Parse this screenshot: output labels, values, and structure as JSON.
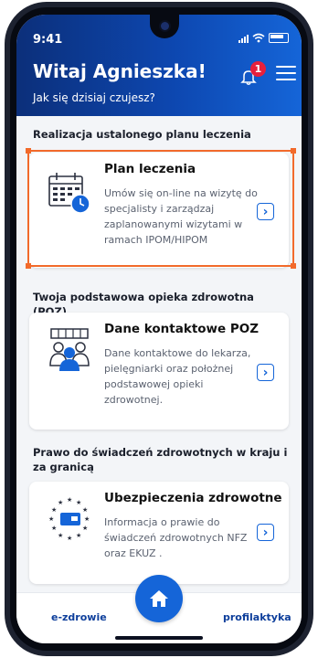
{
  "status": {
    "time": "9:41"
  },
  "header": {
    "greeting": "Witaj Agnieszka!",
    "subtitle": "Jak się dzisiaj czujesz?",
    "notification_count": "1"
  },
  "sections": [
    {
      "title": "Realizacja ustalonego planu leczenia",
      "card_title": "Plan leczenia",
      "card_desc": "Umów się on-line na wizytę do specjalisty i zarządzaj zaplanowanymi wizytami w ramach IPOM/HIPOM",
      "icon": "calendar-clock-icon"
    },
    {
      "title": "Twoja podstawowa opieka zdrowotna (POZ)",
      "card_title": "Dane kontaktowe POZ",
      "card_desc": "Dane kontaktowe do lekarza, pielęgniarki oraz położnej podstawowej opieki zdrowotnej.",
      "icon": "medical-staff-icon"
    },
    {
      "title": "Prawo do świadczeń zdrowotnych w kraju i za granicą",
      "card_title": "Ubezpieczenia zdrowotne",
      "card_desc": "Informacja o prawie do świadczeń zdrowotnych NFZ oraz EKUZ .",
      "icon": "eu-insurance-card-icon"
    }
  ],
  "bottom_nav": {
    "left": "e-zdrowie",
    "right": "profilaktyka",
    "center_icon": "home-icon"
  },
  "colors": {
    "primary": "#1565d8",
    "header_dark": "#0c2f7a",
    "highlight": "#f26a2b",
    "badge": "#e8203c"
  }
}
